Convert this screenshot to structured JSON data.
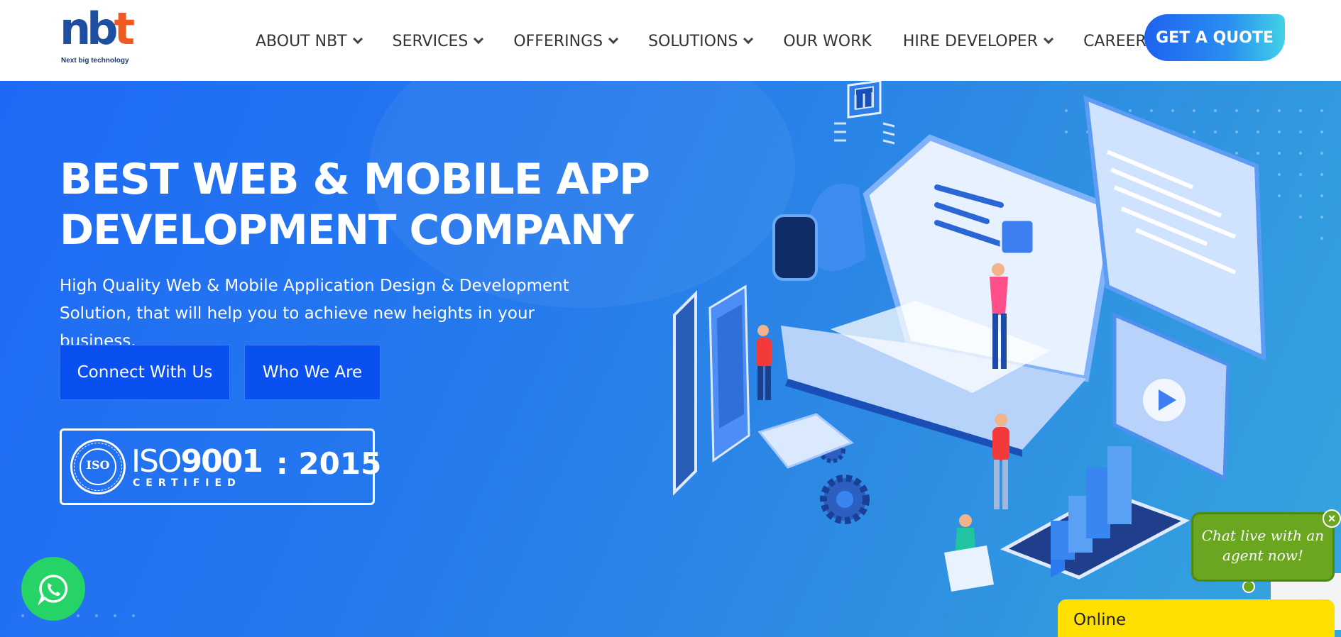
{
  "brand": {
    "logo_letters": [
      "n",
      "b",
      "t"
    ],
    "tagline": "Next big technology",
    "colors": {
      "blue": "#1e4fa0",
      "orange": "#f05a22"
    }
  },
  "nav": {
    "items": [
      {
        "label": "ABOUT NBT",
        "has_dropdown": true
      },
      {
        "label": "SERVICES",
        "has_dropdown": true
      },
      {
        "label": "OFFERINGS",
        "has_dropdown": true
      },
      {
        "label": "SOLUTIONS",
        "has_dropdown": true
      },
      {
        "label": "OUR WORK",
        "has_dropdown": false
      },
      {
        "label": "HIRE DEVELOPER",
        "has_dropdown": true
      },
      {
        "label": "CAREER",
        "has_dropdown": false
      }
    ],
    "cta_label": "GET A QUOTE"
  },
  "hero": {
    "title_bold": "BEST WEB & MOBILE APP",
    "title_light": "DEVELOPMENT COMPANY",
    "subtitle": "High Quality Web & Mobile Application Design & Development Solution, that will help you to achieve new heights in your business.",
    "buttons": {
      "connect": "Connect With Us",
      "who": "Who We Are"
    },
    "iso": {
      "seal_word": "ISO",
      "mark_prefix": "ISO",
      "mark_number": "9001",
      "certified": "CERTIFIED",
      "year": ": 2015"
    }
  },
  "widgets": {
    "chat_prompt": "Chat live with an agent now!",
    "chat_close": "×",
    "online_label": "Online",
    "icons": [
      "whatsapp-icon",
      "close-icon",
      "recaptcha-icon",
      "chevron-down-icon"
    ]
  },
  "theme": {
    "hero_gradient": [
      "#1f6af5",
      "#34a6dd"
    ],
    "primary_button": "#0a4ff0",
    "chat_green": "#6aa620",
    "online_yellow": "#ffe000",
    "whatsapp_green": "#25d366"
  }
}
